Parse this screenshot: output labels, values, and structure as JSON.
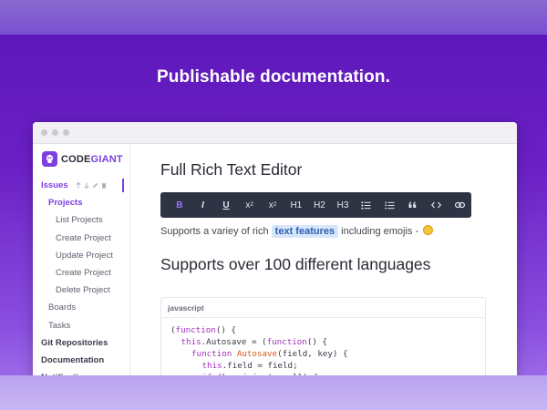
{
  "headline": "Publishable documentation.",
  "colors": {
    "accent": "#7c3fe0",
    "toolbar_bg": "#2f3444",
    "highlight_bg": "#d8e6fb"
  },
  "window": {
    "controls": [
      "close",
      "minimize",
      "maximize"
    ]
  },
  "logo": {
    "text_dark": "CODE",
    "text_accent": "GIANT",
    "icon": "codegiant-logo-icon"
  },
  "sidebar": {
    "issues_label": "Issues",
    "issue_actions": [
      "arrow-up-icon",
      "arrow-down-icon",
      "pencil-icon",
      "trash-icon"
    ],
    "items": [
      {
        "label": "Projects",
        "level": 1,
        "active": true
      },
      {
        "label": "List Projects",
        "level": 2
      },
      {
        "label": "Create Project",
        "level": 2
      },
      {
        "label": "Update Project",
        "level": 2
      },
      {
        "label": "Create Project",
        "level": 2
      },
      {
        "label": "Delete Project",
        "level": 2
      },
      {
        "label": "Boards",
        "level": 1
      },
      {
        "label": "Tasks",
        "level": 1
      },
      {
        "label": "Git Repositories",
        "level": 0
      },
      {
        "label": "Documentation",
        "level": 0
      },
      {
        "label": "Notifications",
        "level": 0
      }
    ]
  },
  "editor": {
    "title": "Full Rich Text Editor",
    "toolbar": {
      "bold": "B",
      "italic": "I",
      "underline": "U",
      "superscript_base": "x",
      "superscript_exp": "2",
      "subscript_base": "x",
      "subscript_idx": "2",
      "h1": "H1",
      "h2": "H2",
      "h3": "H3",
      "icons": [
        "bullet-list-icon",
        "numbered-list-icon",
        "quote-icon",
        "code-icon",
        "link-icon"
      ]
    },
    "paragraph": {
      "before": "Supports a variey of rich ",
      "highlight": "text features",
      "after": " including emojis - ",
      "emoji": "grinning-face-emoji"
    },
    "subtitle": "Supports over 100 different languages",
    "code": {
      "language": "javascript",
      "lines": [
        {
          "indent": 0,
          "parts": [
            {
              "t": "(",
              "c": "pr"
            },
            {
              "t": "function",
              "c": "kw"
            },
            {
              "t": "() {",
              "c": "pr"
            }
          ]
        },
        {
          "indent": 1,
          "parts": [
            {
              "t": "this",
              "c": "kw"
            },
            {
              "t": ".Autosave = (",
              "c": "pr"
            },
            {
              "t": "function",
              "c": "kw"
            },
            {
              "t": "() {",
              "c": "pr"
            }
          ]
        },
        {
          "indent": 2,
          "parts": [
            {
              "t": "function",
              "c": "kw"
            },
            {
              "t": " ",
              "c": "pr"
            },
            {
              "t": "Autosave",
              "c": "fn"
            },
            {
              "t": "(field, key) {",
              "c": "pr"
            }
          ]
        },
        {
          "indent": 3,
          "parts": [
            {
              "t": "this",
              "c": "kw"
            },
            {
              "t": ".field = field;",
              "c": "pr"
            }
          ]
        },
        {
          "indent": 3,
          "parts": [
            {
              "t": "if",
              "c": "kw"
            },
            {
              "t": " (key.join != null) {",
              "c": "pr"
            }
          ]
        }
      ]
    }
  }
}
